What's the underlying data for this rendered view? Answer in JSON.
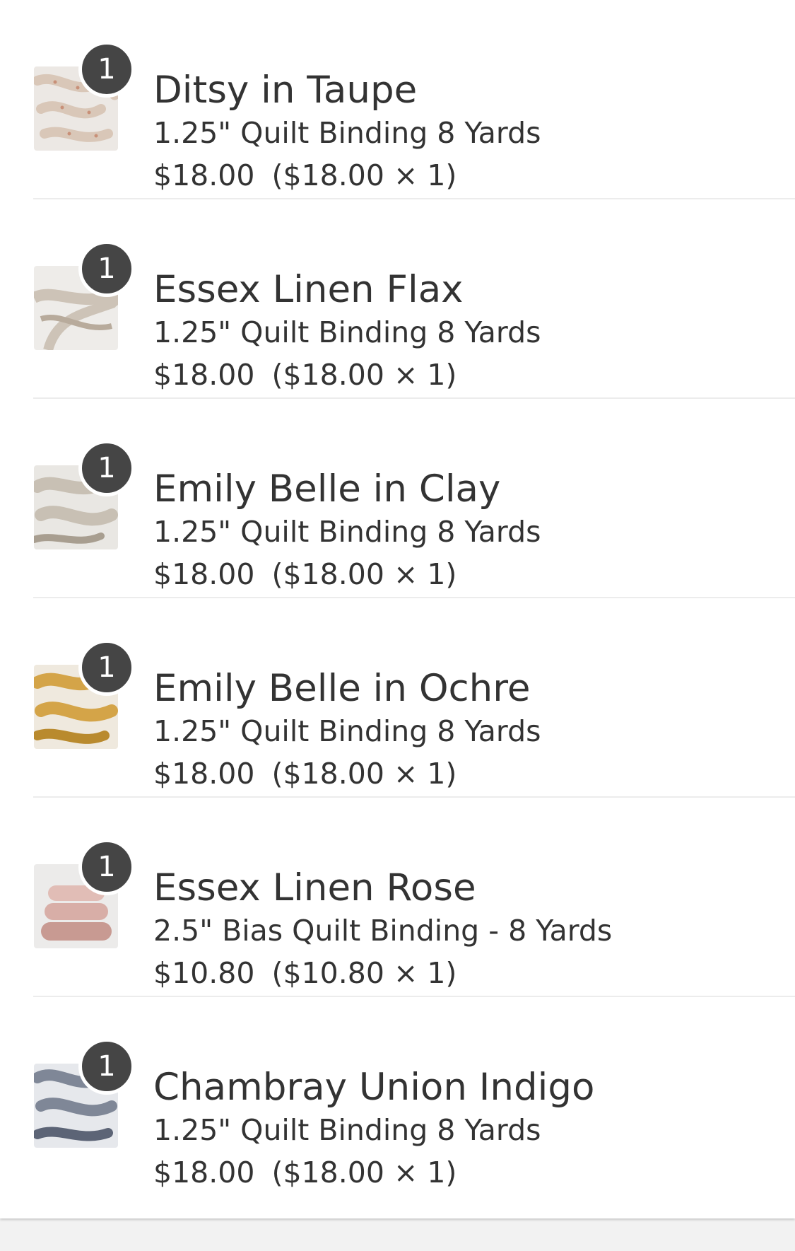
{
  "cart": {
    "items": [
      {
        "title": "Ditsy in Taupe",
        "variant": "1.25\" Quilt Binding 8 Yards",
        "price": "$18.00",
        "breakdown": "($18.00 × 1)",
        "quantity": "1",
        "thumbnail": "taupe floral fabric binding",
        "thumb_colors": {
          "bg": "#ece8e4",
          "fabric": "#d9c7b8",
          "accent": "#c89078"
        }
      },
      {
        "title": "Essex Linen Flax",
        "variant": "1.25\" Quilt Binding 8 Yards",
        "price": "$18.00",
        "breakdown": "($18.00 × 1)",
        "quantity": "1",
        "thumbnail": "flax linen fabric binding",
        "thumb_colors": {
          "bg": "#eeece9",
          "fabric": "#cdc3b7",
          "accent": "#b8ab9c"
        }
      },
      {
        "title": "Emily Belle in Clay",
        "variant": "1.25\" Quilt Binding 8 Yards",
        "price": "$18.00",
        "breakdown": "($18.00 × 1)",
        "quantity": "1",
        "thumbnail": "clay patterned fabric binding",
        "thumb_colors": {
          "bg": "#e9e7e3",
          "fabric": "#c8c0b4",
          "accent": "#a89e90"
        }
      },
      {
        "title": "Emily Belle in Ochre",
        "variant": "1.25\" Quilt Binding 8 Yards",
        "price": "$18.00",
        "breakdown": "($18.00 × 1)",
        "quantity": "1",
        "thumbnail": "ochre patterned fabric binding",
        "thumb_colors": {
          "bg": "#efe9de",
          "fabric": "#d4a448",
          "accent": "#b98a2e"
        }
      },
      {
        "title": "Essex Linen Rose",
        "variant": "2.5\" Bias Quilt Binding - 8 Yards",
        "price": "$10.80",
        "breakdown": "($10.80 × 1)",
        "quantity": "1",
        "thumbnail": "rose linen binding rolls",
        "thumb_colors": {
          "bg": "#ecebea",
          "fabric": "#e1bdb6",
          "accent": "#c89a92"
        }
      },
      {
        "title": "Chambray Union Indigo",
        "variant": "1.25\" Quilt Binding 8 Yards",
        "price": "$18.00",
        "breakdown": "($18.00 × 1)",
        "quantity": "1",
        "thumbnail": "indigo chambray fabric binding",
        "thumb_colors": {
          "bg": "#e6e8ec",
          "fabric": "#7f8797",
          "accent": "#5c6476"
        }
      }
    ]
  }
}
